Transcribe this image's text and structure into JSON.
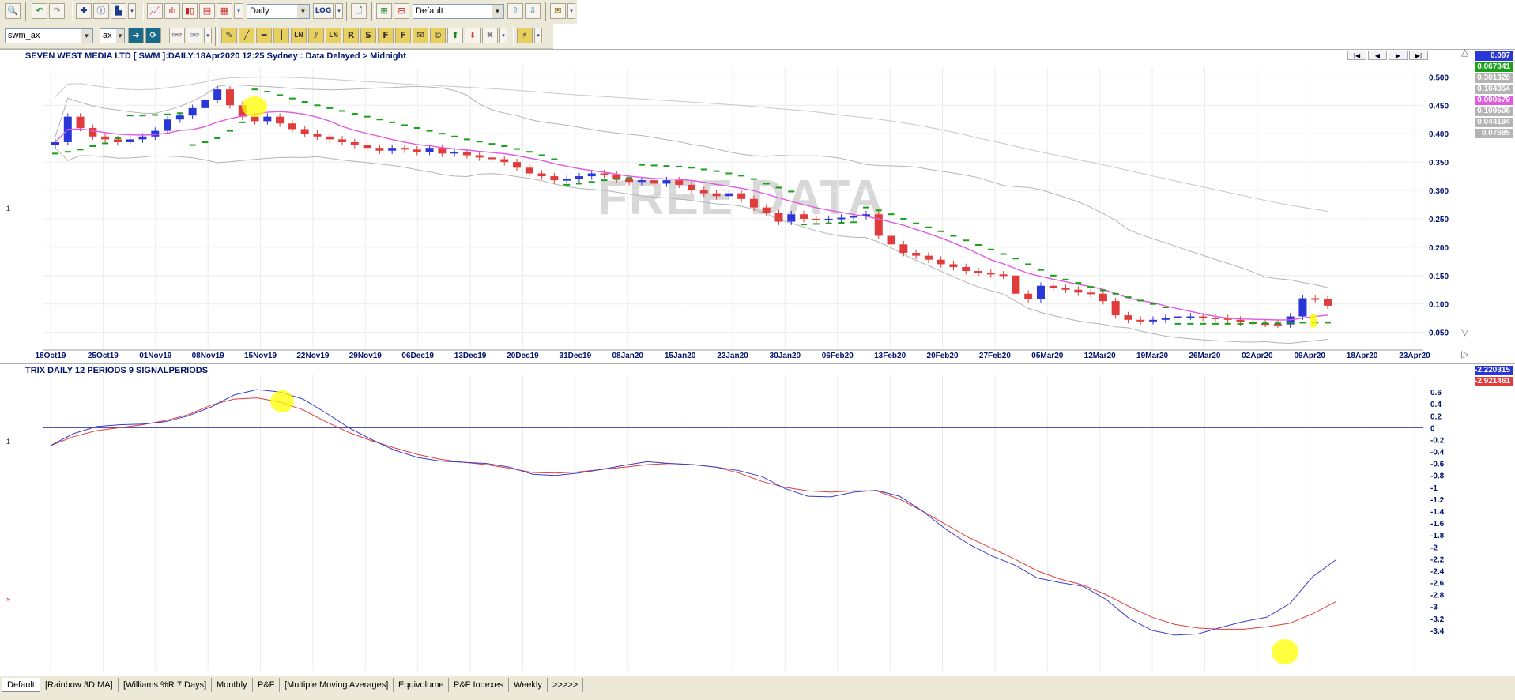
{
  "toolbar1": {
    "period": "Daily",
    "layout": "Default",
    "log_label": "LOG"
  },
  "toolbar2": {
    "symbol": "swm_ax",
    "exchange": "ax",
    "tool_labels": [
      "LN",
      "LN",
      "R",
      "S",
      "F",
      "F"
    ]
  },
  "price_chart": {
    "title": "SEVEN WEST MEDIA LTD [ SWM ]:DAILY:18Apr2020 12:25 Sydney : Data Delayed > Midnight",
    "watermark": "FREE DATA",
    "y_ticks": [
      "0.500",
      "0.450",
      "0.400",
      "0.350",
      "0.300",
      "0.250",
      "0.200",
      "0.150",
      "0.100",
      "0.050"
    ],
    "x_ticks": [
      "18Oct19",
      "25Oct19",
      "01Nov19",
      "08Nov19",
      "15Nov19",
      "22Nov19",
      "29Nov19",
      "06Dec19",
      "13Dec19",
      "20Dec19",
      "31Dec19",
      "08Jan20",
      "15Jan20",
      "22Jan20",
      "30Jan20",
      "06Feb20",
      "13Feb20",
      "20Feb20",
      "27Feb20",
      "05Mar20",
      "12Mar20",
      "19Mar20",
      "26Mar20",
      "02Apr20",
      "09Apr20",
      "18Apr20",
      "23Apr20"
    ],
    "side_label": "1",
    "value_badges": [
      {
        "text": "0.097",
        "color": "#2b36d8"
      },
      {
        "text": "0.067341",
        "color": "#1aa01a"
      },
      {
        "text": "0.301328",
        "color": "#b4b4b4"
      },
      {
        "text": "0.104354",
        "color": "#b4b4b4"
      },
      {
        "text": "0.090579",
        "color": "#e05ae0"
      },
      {
        "text": "0.109506",
        "color": "#b4b4b4"
      },
      {
        "text": "0.044194",
        "color": "#b4b4b4"
      },
      {
        "text": "0.07685",
        "color": "#b4b4b4"
      }
    ]
  },
  "trix_chart": {
    "title": "TRIX DAILY 12 PERIODS 9 SIGNALPERIODS",
    "y_ticks": [
      "0.6",
      "0.4",
      "0.2",
      "0",
      "-0.2",
      "-0.4",
      "-0.6",
      "-0.8",
      "-1",
      "-1.2",
      "-1.4",
      "-1.6",
      "-1.8",
      "-2",
      "-2.2",
      "-2.4",
      "-2.6",
      "-2.8",
      "-3",
      "-3.2",
      "-3.4"
    ],
    "side_label": "1",
    "value_badges": [
      {
        "text": "-2.220315",
        "color": "#2b36d8"
      },
      {
        "text": "-2.921461",
        "color": "#e03c3c"
      }
    ]
  },
  "tabs": [
    "Default",
    "[Rainbow 3D MA]",
    "[Williams %R 7 Days]",
    "Monthly",
    "P&F",
    "[Multiple Moving Averages]",
    "Equivolume",
    "P&F Indexes",
    "Weekly",
    ">>>>>"
  ],
  "colors": {
    "up": "#2b36d8",
    "down": "#e03c3c",
    "sar": "#1aa01a",
    "ma": "#e05ae0",
    "band": "#b4b4b4",
    "trix": "#3c3cc8",
    "signal": "#e03c3c",
    "highlight": "#ffff00"
  },
  "chart_data": [
    {
      "type": "candlestick",
      "title": "SEVEN WEST MEDIA LTD [ SWM ]:DAILY:18Apr2020 12:25 Sydney : Data Delayed > Midnight",
      "ylim": [
        0.03,
        0.52
      ],
      "x_tick_labels": [
        "18Oct19",
        "25Oct19",
        "01Nov19",
        "08Nov19",
        "15Nov19",
        "22Nov19",
        "29Nov19",
        "06Dec19",
        "13Dec19",
        "20Dec19",
        "31Dec19",
        "08Jan20",
        "15Jan20",
        "22Jan20",
        "30Jan20",
        "06Feb20",
        "13Feb20",
        "20Feb20",
        "27Feb20",
        "05Mar20",
        "12Mar20",
        "19Mar20",
        "26Mar20",
        "02Apr20",
        "09Apr20",
        "18Apr20",
        "23Apr20"
      ],
      "series": [
        {
          "name": "close",
          "values": [
            0.385,
            0.43,
            0.41,
            0.395,
            0.39,
            0.385,
            0.39,
            0.395,
            0.405,
            0.425,
            0.432,
            0.445,
            0.46,
            0.478,
            0.45,
            0.43,
            0.422,
            0.43,
            0.418,
            0.408,
            0.4,
            0.395,
            0.39,
            0.385,
            0.38,
            0.375,
            0.37,
            0.375,
            0.372,
            0.368,
            0.375,
            0.365,
            0.368,
            0.362,
            0.358,
            0.355,
            0.35,
            0.34,
            0.33,
            0.325,
            0.318,
            0.32,
            0.325,
            0.33,
            0.328,
            0.32,
            0.315,
            0.318,
            0.312,
            0.318,
            0.31,
            0.3,
            0.295,
            0.29,
            0.295,
            0.285,
            0.27,
            0.26,
            0.245,
            0.258,
            0.25,
            0.248,
            0.25,
            0.252,
            0.255,
            0.258,
            0.22,
            0.205,
            0.19,
            0.185,
            0.178,
            0.17,
            0.165,
            0.158,
            0.155,
            0.152,
            0.15,
            0.118,
            0.108,
            0.132,
            0.128,
            0.125,
            0.12,
            0.118,
            0.105,
            0.08,
            0.072,
            0.07,
            0.072,
            0.075,
            0.078,
            0.078,
            0.076,
            0.075,
            0.072,
            0.068,
            0.066,
            0.065,
            0.064,
            0.078,
            0.11,
            0.108,
            0.097
          ]
        },
        {
          "name": "parabolic_sar",
          "values": [
            0.365,
            0.368,
            0.372,
            0.378,
            0.383,
            0.392,
            0.432,
            0.432,
            0.433,
            0.434,
            0.436,
            0.38,
            0.385,
            0.392,
            0.405,
            0.42,
            0.478,
            0.474,
            0.468,
            0.462,
            0.456,
            0.45,
            0.445,
            0.44,
            0.435,
            0.43,
            0.425,
            0.42,
            0.415,
            0.41,
            0.405,
            0.4,
            0.395,
            0.39,
            0.386,
            0.382,
            0.378,
            0.373,
            0.368,
            0.362,
            0.355,
            0.31,
            0.312,
            0.315,
            0.318,
            0.32,
            0.322,
            0.345,
            0.344,
            0.343,
            0.342,
            0.34,
            0.337,
            0.334,
            0.33,
            0.326,
            0.32,
            0.312,
            0.305,
            0.298,
            0.24,
            0.241,
            0.242,
            0.243,
            0.244,
            0.27,
            0.265,
            0.258,
            0.25,
            0.242,
            0.235,
            0.228,
            0.22,
            0.212,
            0.204,
            0.196,
            0.188,
            0.18,
            0.17,
            0.16,
            0.15,
            0.143,
            0.137,
            0.13,
            0.124,
            0.118,
            0.112,
            0.106,
            0.1,
            0.094,
            0.065,
            0.065,
            0.065,
            0.065,
            0.065,
            0.065,
            0.066,
            0.066,
            0.066,
            0.067,
            0.067,
            0.067,
            0.067
          ]
        }
      ]
    },
    {
      "type": "line",
      "title": "TRIX DAILY 12 PERIODS 9 SIGNALPERIODS",
      "ylim": [
        -3.6,
        0.8
      ],
      "series": [
        {
          "name": "trix",
          "values": [
            -0.3,
            -0.1,
            0.02,
            0.05,
            0.06,
            0.1,
            0.2,
            0.35,
            0.55,
            0.64,
            0.6,
            0.48,
            0.25,
            0.0,
            -0.2,
            -0.38,
            -0.5,
            -0.56,
            -0.58,
            -0.6,
            -0.66,
            -0.78,
            -0.8,
            -0.76,
            -0.7,
            -0.63,
            -0.57,
            -0.6,
            -0.62,
            -0.66,
            -0.72,
            -0.82,
            -1.02,
            -1.15,
            -1.16,
            -1.08,
            -1.05,
            -1.15,
            -1.4,
            -1.7,
            -1.95,
            -2.15,
            -2.3,
            -2.52,
            -2.6,
            -2.66,
            -2.88,
            -3.2,
            -3.4,
            -3.48,
            -3.46,
            -3.35,
            -3.25,
            -3.18,
            -2.95,
            -2.5,
            -2.22
          ]
        },
        {
          "name": "signal",
          "values": [
            -0.3,
            -0.15,
            -0.05,
            0.0,
            0.05,
            0.12,
            0.22,
            0.38,
            0.48,
            0.5,
            0.43,
            0.3,
            0.1,
            -0.08,
            -0.22,
            -0.34,
            -0.45,
            -0.53,
            -0.58,
            -0.62,
            -0.68,
            -0.75,
            -0.76,
            -0.74,
            -0.7,
            -0.66,
            -0.62,
            -0.6,
            -0.62,
            -0.66,
            -0.76,
            -0.9,
            -1.0,
            -1.06,
            -1.08,
            -1.06,
            -1.06,
            -1.2,
            -1.4,
            -1.62,
            -1.84,
            -2.02,
            -2.2,
            -2.4,
            -2.54,
            -2.64,
            -2.8,
            -3.0,
            -3.18,
            -3.3,
            -3.36,
            -3.38,
            -3.38,
            -3.34,
            -3.28,
            -3.12,
            -2.92
          ]
        }
      ]
    }
  ]
}
